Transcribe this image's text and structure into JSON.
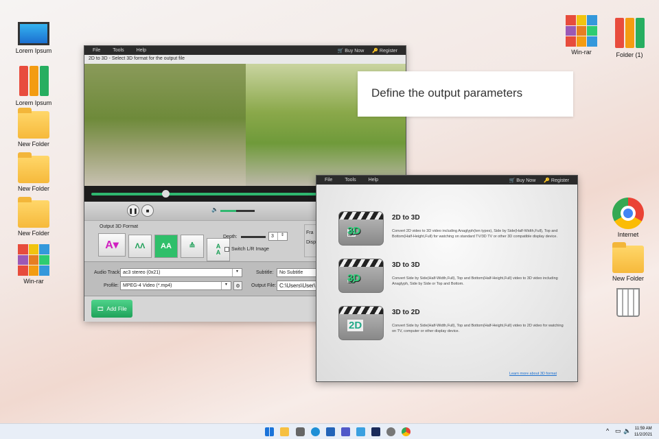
{
  "desktop": {
    "left_icons": [
      {
        "label": "Lorem Ipsum",
        "icon": "monitor-icon"
      },
      {
        "label": "Lorem Ipsum",
        "icon": "binders-icon"
      },
      {
        "label": "New Folder",
        "icon": "folder-icon"
      },
      {
        "label": "New Folder",
        "icon": "folder-icon"
      },
      {
        "label": "New Folder",
        "icon": "folder-icon"
      },
      {
        "label": "Win-rar",
        "icon": "winrar-icon"
      }
    ],
    "right_icons": [
      {
        "label": "Win-rar"
      },
      {
        "label": "Folder (1)"
      },
      {
        "label": "Internet"
      },
      {
        "label": "New Folder"
      }
    ]
  },
  "main_window": {
    "menu": [
      "File",
      "Tools",
      "Help"
    ],
    "buy_now": "Buy Now",
    "register": "Register",
    "caption": "2D to 3D - Select 3D format for the output file",
    "output_format_label": "Output 3D Format",
    "depth_label": "Depth:",
    "depth_value": "3",
    "switch_label": "Switch L/R Image",
    "frame_label": "Fra",
    "disp_label": "Disp",
    "audio_track_label": "Audio Track:",
    "audio_track_value": "ac3 stereo (0x21)",
    "subtitle_label": "Subtitle:",
    "subtitle_value": "No Subtitle",
    "profile_label": "Profile:",
    "profile_value": "MPEG-4 Video (*.mp4)",
    "output_file_label": "Output File:",
    "output_file_value": "C:\\Users\\User\\Docu",
    "add_file": "Add File",
    "seek_progress": 0.24,
    "volume": 0.45
  },
  "tooltip": "Define the output parameters",
  "mode_window": {
    "menu": [
      "File",
      "Tools",
      "Help"
    ],
    "buy_now": "Buy Now",
    "register": "Register",
    "modes": [
      {
        "title": "2D to 3D",
        "from": "2D",
        "to": "3D",
        "desc": "Convert 2D video to 3D video including Anaglyph(ten types), Side by Side(Half-Width,Full), Top and Bottom(Half-Height,Full) for watching on standard TV/3D TV or other 3D compatible display device."
      },
      {
        "title": "3D to 3D",
        "from": "3D",
        "to": "3D",
        "desc": "Convert Side by Side(Half-Width,Full), Top and Bottom(Half-Height,Full) video to 3D video including Anaglyph, Side by Side or Top and Bottom."
      },
      {
        "title": "3D to 2D",
        "from": "3D",
        "to": "2D",
        "desc": "Convert Side by Side(Half-Width,Full), Top and Bottom(Half-Height,Full) video to 2D video for watching on TV, computer or other display device."
      }
    ],
    "to_word": "to",
    "learn_more": "Learn more about 3D format"
  },
  "taskbar": {
    "time": "11:59 AM",
    "date": "11/2/2021"
  }
}
